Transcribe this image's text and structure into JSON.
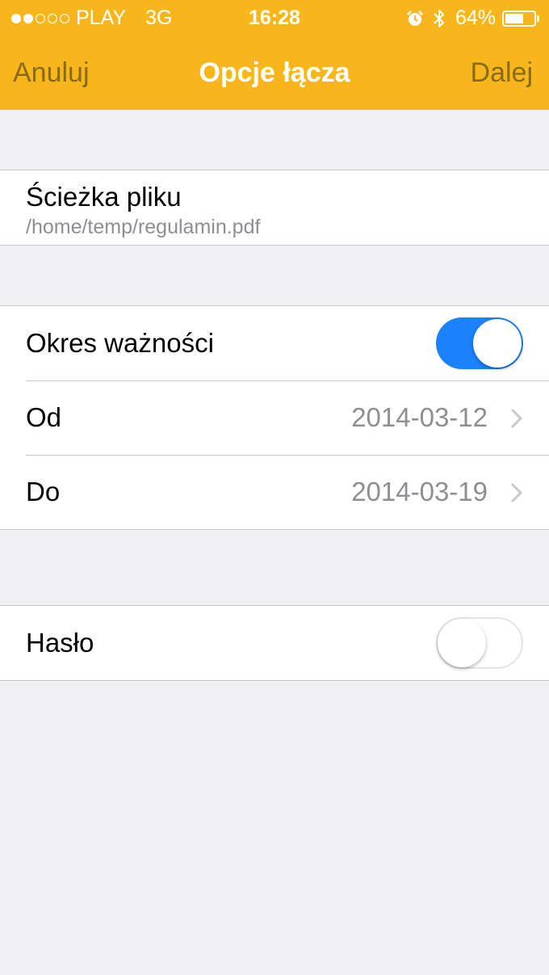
{
  "status_bar": {
    "signal_bars": 5,
    "signal_filled": 2,
    "carrier": "PLAY",
    "network": "3G",
    "time": "16:28",
    "battery_percent_label": "64%",
    "battery_level": 0.64,
    "icons": [
      "alarm-icon",
      "bluetooth-icon",
      "battery-icon"
    ]
  },
  "nav": {
    "cancel_label": "Anuluj",
    "title": "Opcje łącza",
    "next_label": "Dalej"
  },
  "file": {
    "title": "Ścieżka pliku",
    "path": "/home/temp/regulamin.pdf"
  },
  "validity": {
    "label": "Okres ważności",
    "enabled": true,
    "from_label": "Od",
    "from_value": "2014-03-12",
    "to_label": "Do",
    "to_value": "2014-03-19"
  },
  "password": {
    "label": "Hasło",
    "enabled": false
  },
  "colors": {
    "header_bg": "#f7b71c",
    "nav_button": "#8a6a17",
    "toggle_on": "#1a82fb",
    "page_bg": "#efeff4",
    "secondary_text": "#8e8e93"
  }
}
